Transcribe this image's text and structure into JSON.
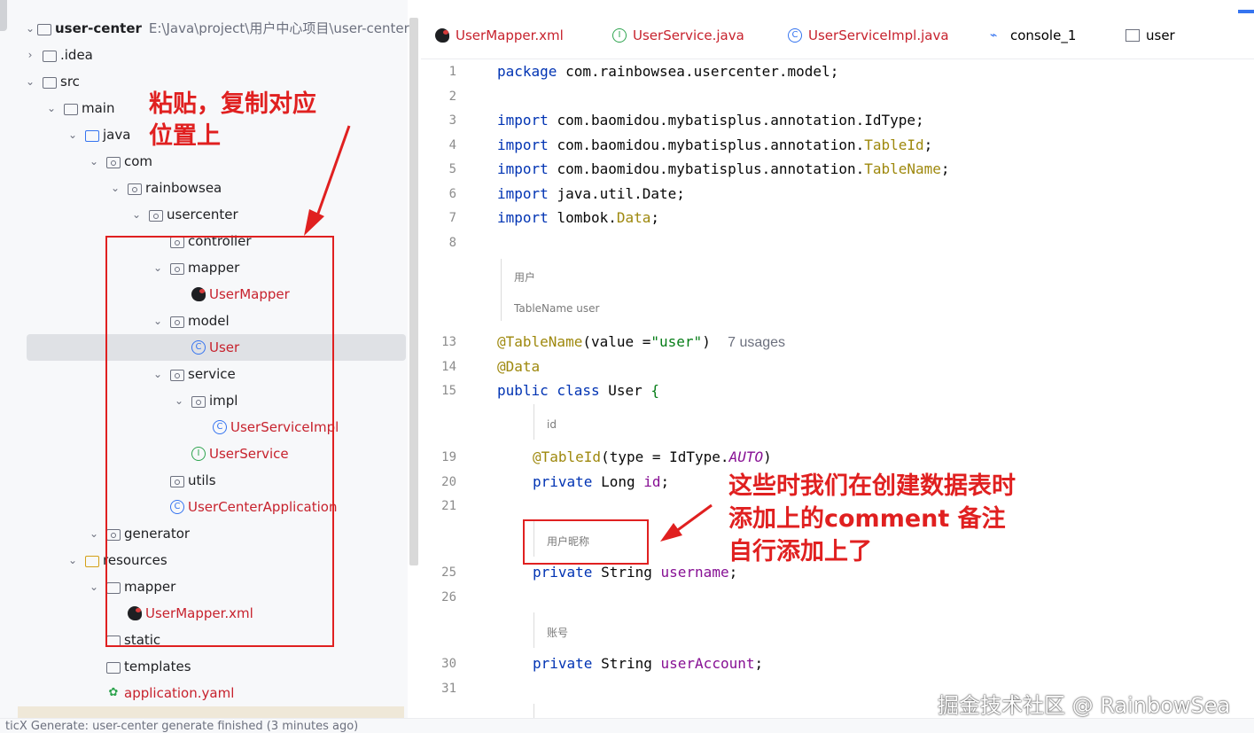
{
  "project": {
    "name": "user-center",
    "path": "E:\\Java\\project\\用户中心项目\\user-center"
  },
  "tree": [
    {
      "label": "user-center",
      "icon": "folder-icon"
    },
    {
      "label": ".idea",
      "icon": "folder-icon"
    },
    {
      "label": "src",
      "icon": "folder-icon"
    },
    {
      "label": "main",
      "icon": "folder-icon"
    },
    {
      "label": "java",
      "icon": "source-folder-icon"
    },
    {
      "label": "com",
      "icon": "package-icon"
    },
    {
      "label": "rainbowsea",
      "icon": "package-icon"
    },
    {
      "label": "usercenter",
      "icon": "package-icon"
    },
    {
      "label": "controller",
      "icon": "package-icon"
    },
    {
      "label": "mapper",
      "icon": "package-icon"
    },
    {
      "label": "UserMapper",
      "icon": "mybatis-icon"
    },
    {
      "label": "model",
      "icon": "package-icon"
    },
    {
      "label": "User",
      "icon": "class-icon"
    },
    {
      "label": "service",
      "icon": "package-icon"
    },
    {
      "label": "impl",
      "icon": "package-icon"
    },
    {
      "label": "UserServiceImpl",
      "icon": "class-icon"
    },
    {
      "label": "UserService",
      "icon": "interface-icon"
    },
    {
      "label": "utils",
      "icon": "package-icon"
    },
    {
      "label": "UserCenterApplication",
      "icon": "spring-class-icon"
    },
    {
      "label": "generator",
      "icon": "package-icon"
    },
    {
      "label": "resources",
      "icon": "resources-folder-icon"
    },
    {
      "label": "mapper",
      "icon": "folder-icon"
    },
    {
      "label": "UserMapper.xml",
      "icon": "mybatis-icon"
    },
    {
      "label": "static",
      "icon": "folder-icon"
    },
    {
      "label": "templates",
      "icon": "folder-icon"
    },
    {
      "label": "application.yaml",
      "icon": "yaml-icon"
    }
  ],
  "tabs": [
    {
      "label": "UserMapper.xml",
      "icon": "mybatis-icon"
    },
    {
      "label": "UserService.java",
      "icon": "interface-icon"
    },
    {
      "label": "UserServiceImpl.java",
      "icon": "class-icon"
    },
    {
      "label": "console_1",
      "icon": "console-icon"
    },
    {
      "label": "user",
      "icon": "table-icon"
    }
  ],
  "code": {
    "line_numbers": [
      "1",
      "2",
      "3",
      "4",
      "5",
      "6",
      "7",
      "8",
      "13",
      "14",
      "15",
      "19",
      "20",
      "21",
      "25",
      "26",
      "30",
      "31"
    ],
    "package_kw": "package",
    "package_name": "com.rainbowsea.usercenter.model;",
    "import_kw": "import",
    "imports": [
      {
        "pre": "com.baomidou.mybatisplus.annotation.IdType;",
        "hl": "",
        "post": ""
      },
      {
        "pre": "com.baomidou.mybatisplus.annotation.",
        "hl": "TableId",
        "post": ";"
      },
      {
        "pre": "com.baomidou.mybatisplus.annotation.",
        "hl": "TableName",
        "post": ";"
      },
      {
        "pre": "java.util.Date;",
        "hl": "",
        "post": ""
      },
      {
        "pre": "lombok.",
        "hl": "Data",
        "post": ";"
      }
    ],
    "doc_class": "用户",
    "doc_tablename": "TableName  user",
    "tablename_ann": "@TableName",
    "tablename_args_pre": "(value =",
    "tablename_value": "\"user\"",
    "tablename_args_post": ")",
    "usages": "7 usages",
    "data_ann": "@Data",
    "class_kw": "public class",
    "class_name": "User",
    "class_brace": "{",
    "doc_id": "id",
    "tableid_ann": "@TableId",
    "tableid_args_pre": "(type = IdType.",
    "tableid_auto": "AUTO",
    "tableid_args_post": ")",
    "private_kw": "private",
    "id_type": "Long",
    "id_name": "id",
    "doc_username": "用户昵称",
    "username_type": "String",
    "username_name": "username",
    "doc_account": "账号",
    "account_type": "String",
    "account_name": "userAccount",
    "semicolon": ";"
  },
  "callouts": {
    "paste_line1": "粘贴，复制对应",
    "paste_line2": "位置上",
    "comment_line1": "这些时我们在创建数据表时",
    "comment_line2": "添加上的comment 备注",
    "comment_line3": "自行添加上了"
  },
  "watermark": "掘金技术社区 @ RainbowSea",
  "status_text": "ticX Generate: user-center generate finished (3 minutes ago)",
  "colors": {
    "annotation_red": "#e02020",
    "keyword": "#0033b3",
    "annotation": "#9e880d",
    "string": "#067d17",
    "field": "#871094"
  }
}
